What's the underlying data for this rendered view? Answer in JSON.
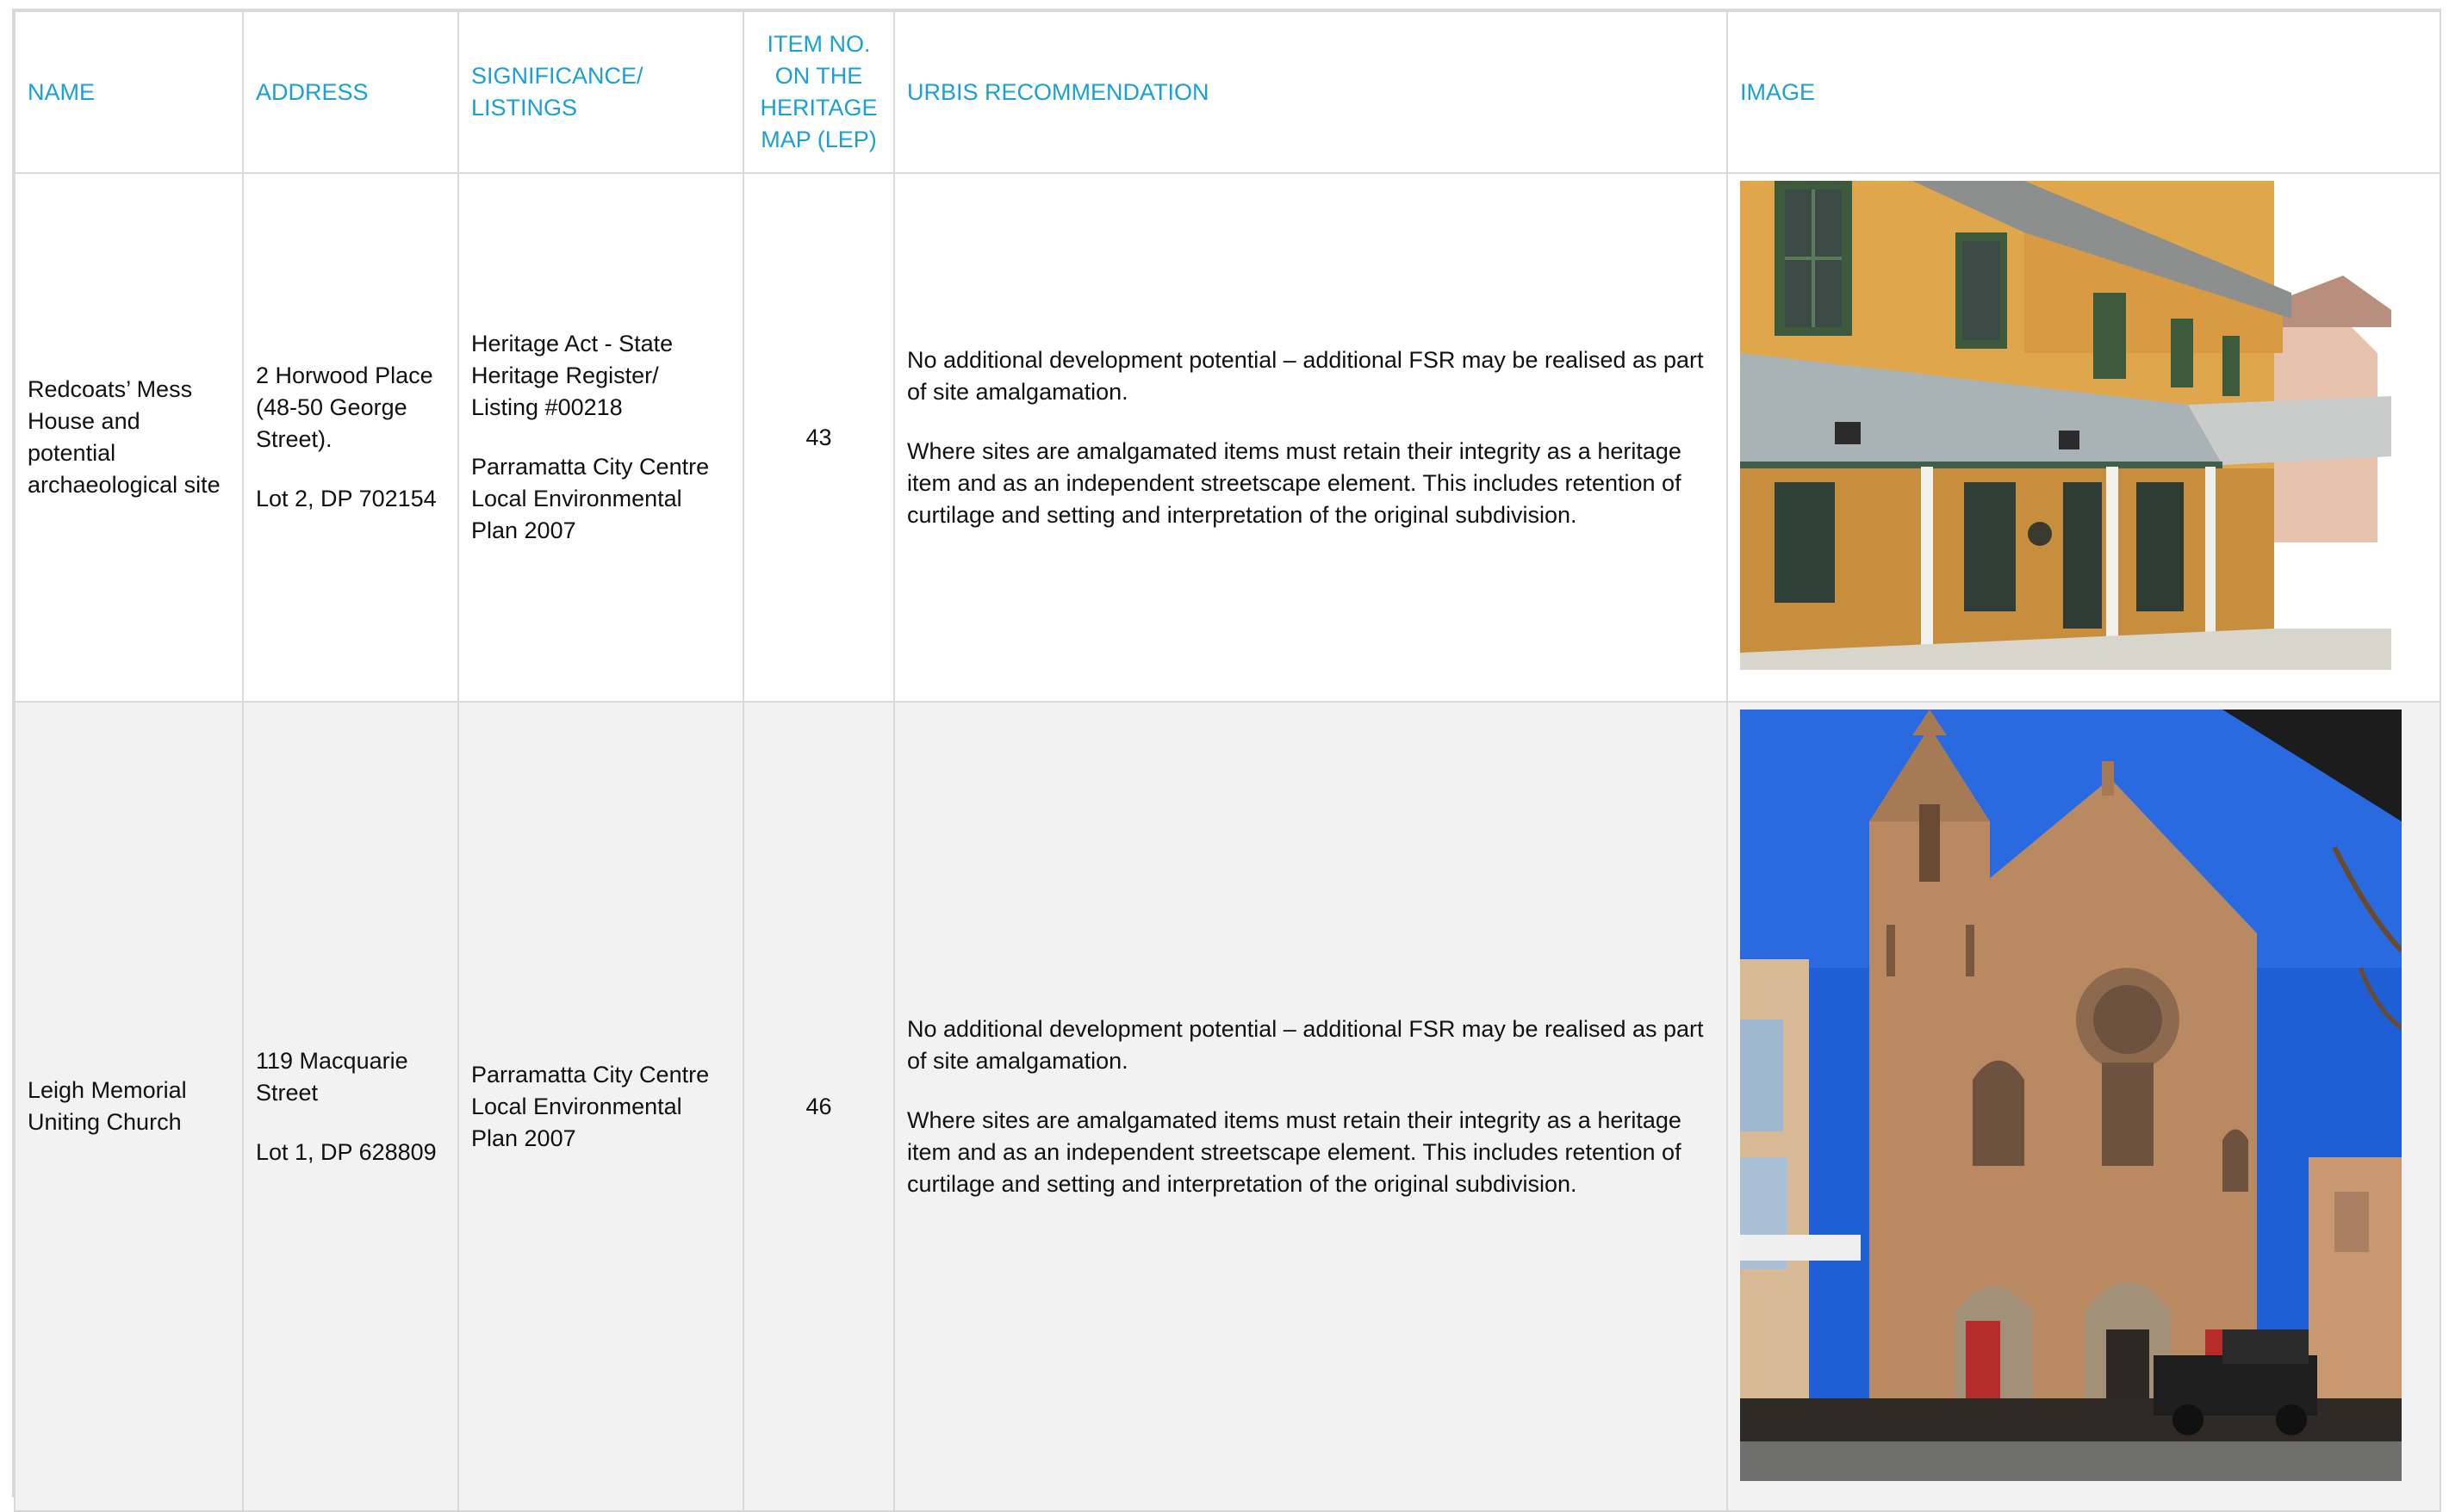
{
  "columns": {
    "name": "NAME",
    "address": "ADDRESS",
    "significance": "SIGNIFICANCE/ LISTINGS",
    "item_no": "ITEM NO. ON THE HERITAGE MAP (LEP)",
    "recommendation": "URBIS RECOMMENDATION",
    "image": "IMAGE"
  },
  "rows": [
    {
      "name": "Redcoats’ Mess House and potential archaeological site",
      "address": "2 Horwood Place (48-50 George Street).",
      "lot": "Lot 2, DP 702154",
      "significance": [
        "Heritage Act - State Heritage Register/ Listing #00218",
        "Parramatta City Centre Local Environmental Plan 2007"
      ],
      "item_no": "43",
      "recommendation": [
        "No additional development potential – additional FSR may be realised as part of site amalgamation.",
        "Where sites are amalgamated items must retain their integrity as a heritage item and as an independent streetscape element. This includes retention of curtilage and setting and interpretation of the original subdivision."
      ],
      "image_subject": "two-storey yellow brick building with verandah"
    },
    {
      "name": "Leigh Memorial Uniting Church",
      "address": "119 Macquarie Street",
      "lot": "Lot 1, DP 628809",
      "significance": [
        "Parramatta City Centre Local Environmental Plan 2007"
      ],
      "item_no": "46",
      "recommendation": [
        "No additional development potential – additional FSR may be realised as part of site amalgamation.",
        "Where sites are amalgamated items must retain their integrity as a heritage item and as an independent streetscape element. This includes retention of curtilage and setting and interpretation of the original subdivision."
      ],
      "image_subject": "sandstone gothic church with bell tower"
    }
  ],
  "colors": {
    "header_text": "#1aa0d6",
    "border": "#d9d9d9",
    "alt_row": "#f2f2f2",
    "brick_yellow": "#e0a64c",
    "sky_blue": "#1f5fd6",
    "sandstone": "#b98a62"
  }
}
